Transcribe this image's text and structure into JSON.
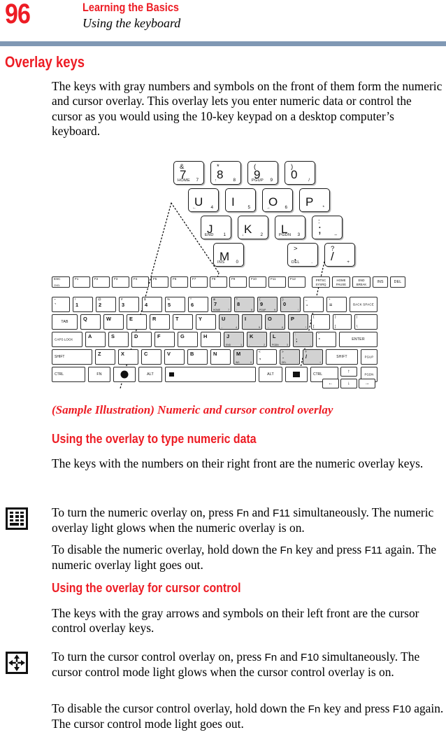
{
  "header": {
    "page_number": "96",
    "chapter": "Learning the Basics",
    "section": "Using the keyboard",
    "rule_color": "#8098b4",
    "accent_color": "#ed1c24"
  },
  "headings": {
    "h1_overlay_keys": "Overlay keys",
    "h2_numeric": "Using the overlay to type numeric data",
    "h2_cursor": "Using the overlay for cursor control"
  },
  "paragraphs": {
    "intro": "The keys with gray numbers and symbols on the front of them form the numeric and cursor overlay. This overlay lets you enter numeric data or control the cursor as you would using the 10-key keypad on a desktop computer’s keyboard.",
    "numeric_keys": "The keys with the numbers on their right front are the numeric overlay keys.",
    "numeric_on_1": "To turn the numeric overlay on, press ",
    "numeric_on_fn": "Fn",
    "numeric_on_2": " and ",
    "numeric_on_f11": "F11",
    "numeric_on_3": " simultaneously. The numeric overlay light glows when the numeric overlay is on.",
    "numeric_off_1": "To disable the numeric overlay, hold down the ",
    "numeric_off_fn": "Fn",
    "numeric_off_2": " key and press ",
    "numeric_off_f11": "F11",
    "numeric_off_3": " again. The numeric overlay light goes out.",
    "cursor_keys": "The keys with the gray arrows and symbols on their left front are the cursor control overlay keys.",
    "cursor_on_1": "To turn the cursor control overlay on, press ",
    "cursor_on_fn": "Fn",
    "cursor_on_2": " and ",
    "cursor_on_f10": "F10",
    "cursor_on_3": " simultaneously. The cursor control mode light glows when the cursor control overlay is on.",
    "cursor_off_1": "To disable the cursor control overlay, hold down the ",
    "cursor_off_fn": "Fn",
    "cursor_off_2": " key and press ",
    "cursor_off_f10": "F10",
    "cursor_off_3": " again. The cursor control mode light goes out."
  },
  "figure": {
    "caption": "(Sample Illustration) Numeric and cursor control overlay",
    "magnified_keys": [
      {
        "top": "&",
        "big": "7",
        "ll": "HOME",
        "lr": "7"
      },
      {
        "top": "*",
        "big": "8",
        "ll": "↑",
        "lr": "8"
      },
      {
        "top": "(",
        "big": "9",
        "ll": "PGUP",
        "lr": "9"
      },
      {
        "top": ")",
        "big": "0",
        "ll": "",
        "lr": "/"
      },
      {
        "top": "",
        "big": "U",
        "ll": "←",
        "lr": "4"
      },
      {
        "top": "",
        "big": "I",
        "ll": "",
        "lr": "5"
      },
      {
        "top": "",
        "big": "O",
        "ll": "→",
        "lr": "6"
      },
      {
        "top": "",
        "big": "P",
        "ll": "",
        "lr": "*"
      },
      {
        "top": "",
        "big": "J",
        "ll": "END",
        "lr": "1"
      },
      {
        "top": "",
        "big": "K",
        "ll": "↓",
        "lr": "2"
      },
      {
        "top": "",
        "big": "L",
        "ll": "PGDN",
        "lr": "3"
      },
      {
        "top": ":",
        "big": ";",
        "ll": "",
        "lr": "–"
      },
      {
        "top": "",
        "big": "M",
        "ll": "INS",
        "lr": "0"
      },
      {
        "top": ">",
        "big": ".",
        "ll": "DEL",
        "lr": "."
      },
      {
        "top": "?",
        "big": "/",
        "ll": "",
        "lr": "+"
      }
    ],
    "function_row": [
      {
        "main": "ESC",
        "sub": "CNCL"
      },
      {
        "main": "F1",
        "sub": ""
      },
      {
        "main": "F2",
        "sub": ""
      },
      {
        "main": "F3",
        "sub": ""
      },
      {
        "main": "F4",
        "sub": ""
      },
      {
        "main": "F5",
        "sub": ""
      },
      {
        "main": "F6",
        "sub": ""
      },
      {
        "main": "F7",
        "sub": ""
      },
      {
        "main": "F8",
        "sub": ""
      },
      {
        "main": "F9",
        "sub": ""
      },
      {
        "main": "F10",
        "sub": ""
      },
      {
        "main": "F11",
        "sub": ""
      },
      {
        "main": "F12",
        "sub": ""
      }
    ],
    "function_row_right": [
      {
        "l1": "PRTSC",
        "l2": "SYSRQ"
      },
      {
        "l1": "HOME",
        "l2": "PAUSE"
      },
      {
        "l1": "END",
        "l2": "BREAK"
      },
      {
        "l1": "INS",
        "l2": ""
      },
      {
        "l1": "DEL",
        "l2": ""
      }
    ],
    "number_row": [
      {
        "top": "~",
        "big": "`",
        "overlay": false
      },
      {
        "top": "!",
        "big": "1",
        "overlay": false
      },
      {
        "top": "@",
        "big": "2",
        "overlay": false
      },
      {
        "top": "#",
        "big": "3",
        "overlay": false
      },
      {
        "top": "$",
        "big": "4",
        "overlay": false
      },
      {
        "top": "%",
        "big": "5",
        "overlay": false
      },
      {
        "top": "^",
        "big": "6",
        "overlay": false
      },
      {
        "top": "&",
        "big": "7",
        "ll": "HOME",
        "lr": "7",
        "overlay": true
      },
      {
        "top": "*",
        "big": "8",
        "ll": "↑",
        "lr": "8",
        "overlay": true
      },
      {
        "top": "(",
        "big": "9",
        "ll": "PGUP",
        "lr": "9",
        "overlay": true
      },
      {
        "top": ")",
        "big": "0",
        "lr": "/",
        "overlay": true
      },
      {
        "top": "_",
        "big": "-",
        "overlay": false
      },
      {
        "top": "+",
        "big": "=",
        "overlay": false
      }
    ],
    "backspace_label": "BACK SPACE",
    "qwerty_row": [
      {
        "big": "TAB",
        "overlay": false
      },
      {
        "big": "Q",
        "overlay": false
      },
      {
        "big": "W",
        "overlay": false
      },
      {
        "big": "E",
        "overlay": false
      },
      {
        "big": "R",
        "overlay": false
      },
      {
        "big": "T",
        "overlay": false
      },
      {
        "big": "Y",
        "overlay": false
      },
      {
        "big": "U",
        "ll": "←",
        "lr": "4",
        "overlay": true
      },
      {
        "big": "I",
        "lr": "5",
        "overlay": true
      },
      {
        "big": "O",
        "ll": "→",
        "lr": "6",
        "overlay": true
      },
      {
        "big": "P",
        "lr": "*",
        "overlay": true
      },
      {
        "big": "{",
        "top": "[",
        "overlay": false
      },
      {
        "big": "}",
        "top": "]",
        "overlay": false
      },
      {
        "big": "|",
        "top": "\\",
        "overlay": false
      }
    ],
    "home_row": [
      {
        "big": "CAPS LOCK",
        "overlay": false
      },
      {
        "big": "A",
        "overlay": false
      },
      {
        "big": "S",
        "overlay": false
      },
      {
        "big": "D",
        "overlay": false
      },
      {
        "big": "F",
        "overlay": false
      },
      {
        "big": "G",
        "overlay": false
      },
      {
        "big": "H",
        "overlay": false
      },
      {
        "big": "J",
        "ll": "END",
        "lr": "1",
        "overlay": true
      },
      {
        "big": "K",
        "ll": "↓",
        "lr": "2",
        "overlay": true
      },
      {
        "big": "L",
        "ll": "PGDN",
        "lr": "3",
        "overlay": true
      },
      {
        "big": ";",
        "top": ":",
        "lr": "–",
        "overlay": true
      },
      {
        "big": "'",
        "top": "\"",
        "overlay": false
      },
      {
        "big": "ENTER",
        "overlay": false
      }
    ],
    "shift_row": [
      {
        "big": "SHIFT",
        "overlay": false
      },
      {
        "big": "Z",
        "overlay": false
      },
      {
        "big": "X",
        "overlay": false
      },
      {
        "big": "C",
        "overlay": false
      },
      {
        "big": "V",
        "overlay": false
      },
      {
        "big": "B",
        "overlay": false
      },
      {
        "big": "N",
        "overlay": false
      },
      {
        "big": "M",
        "ll": "INS",
        "lr": "0",
        "overlay": true
      },
      {
        "big": ",",
        "top": "<",
        "overlay": false
      },
      {
        "big": ".",
        "top": ">",
        "ll": "DEL",
        "lr": ".",
        "overlay": true
      },
      {
        "big": "/",
        "top": "?",
        "lr": "+",
        "overlay": true
      },
      {
        "big": "SHIFT",
        "overlay": false
      }
    ],
    "bottom_row": [
      {
        "big": "CTRL"
      },
      {
        "big": "FN"
      },
      {
        "big": "WIN"
      },
      {
        "big": "ALT"
      },
      {
        "big": "SPACE"
      },
      {
        "big": "ALT"
      },
      {
        "big": "MENU"
      },
      {
        "big": "CTRL"
      }
    ],
    "nav_keys": {
      "pgup": "PGUP",
      "pgdn": "PGDN",
      "up": "↑",
      "down": "↓",
      "left": "←",
      "right": "→"
    }
  },
  "margin_icons": {
    "numeric_keypad": "numeric-keypad-icon",
    "cursor_arrows": "cursor-arrows-icon"
  }
}
